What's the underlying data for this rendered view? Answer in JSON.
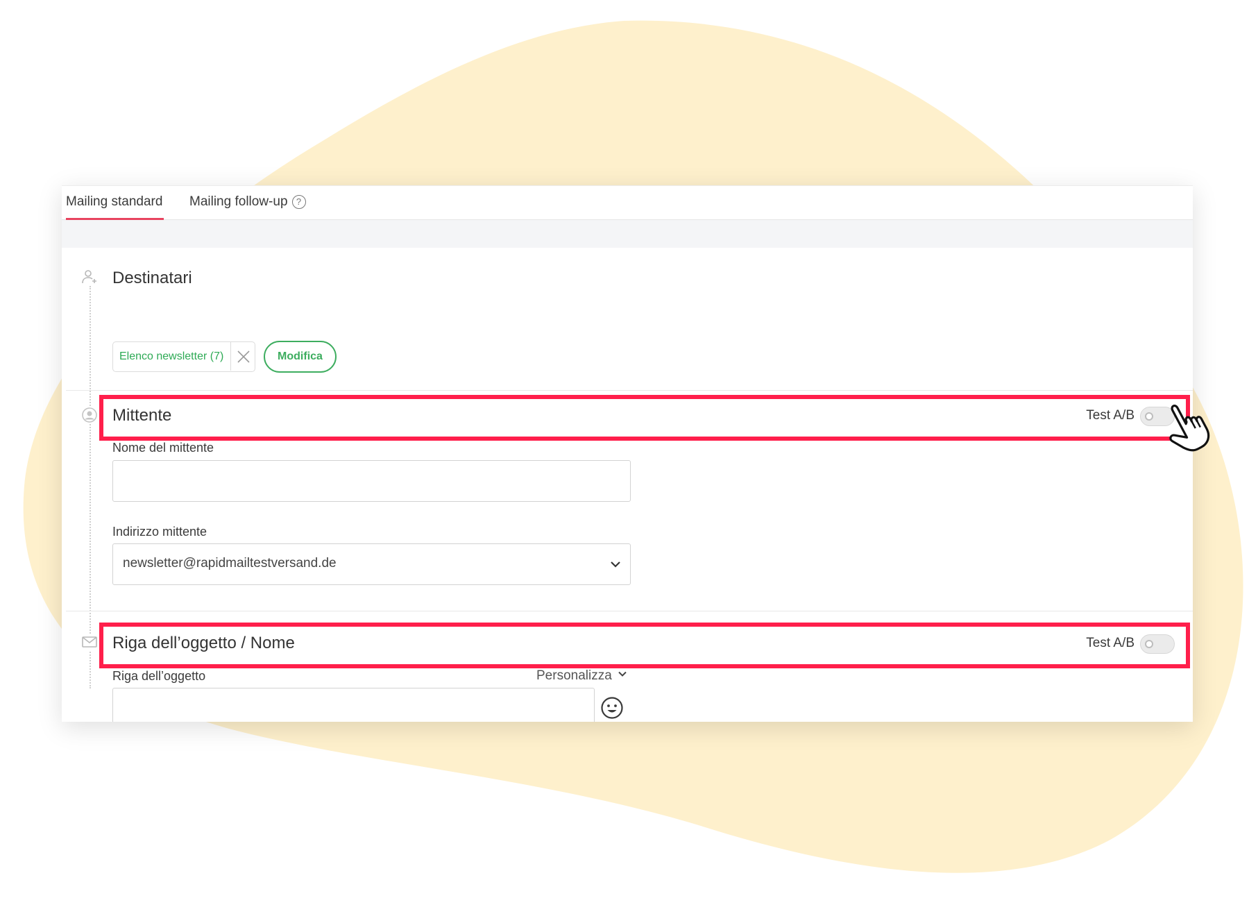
{
  "tabs": [
    {
      "label": "Mailing standard",
      "active": true
    },
    {
      "label": "Mailing follow-up",
      "active": false
    }
  ],
  "recipients": {
    "title": "Destinatari",
    "list_chip": "Elenco newsletter (7)",
    "edit_button": "Modifica"
  },
  "sender": {
    "title": "Mittente",
    "ab_test_label": "Test A/B",
    "ab_test_on": false,
    "name_label": "Nome del mittente",
    "name_value": "",
    "address_label": "Indirizzo mittente",
    "address_value": "newsletter@rapidmailtestversand.de"
  },
  "subject": {
    "title": "Riga dell’oggetto / Nome",
    "ab_test_label": "Test A/B",
    "ab_test_on": false,
    "line_label": "Riga dell’oggetto",
    "personalize_label": "Personalizza",
    "line_value": ""
  },
  "colors": {
    "accent_tab": "#e8435f",
    "highlight": "#ff1f4b",
    "green": "#3dad5f",
    "blob": "#fef0cc"
  },
  "icons": {
    "tab_help": "question-circle-icon",
    "recipients": "user-plus-icon",
    "sender": "user-circle-icon",
    "subject": "envelope-icon",
    "chip_remove": "close-icon",
    "dropdown": "chevron-down-icon",
    "emoji": "smiley-icon",
    "cursor": "hand-pointer-icon"
  }
}
